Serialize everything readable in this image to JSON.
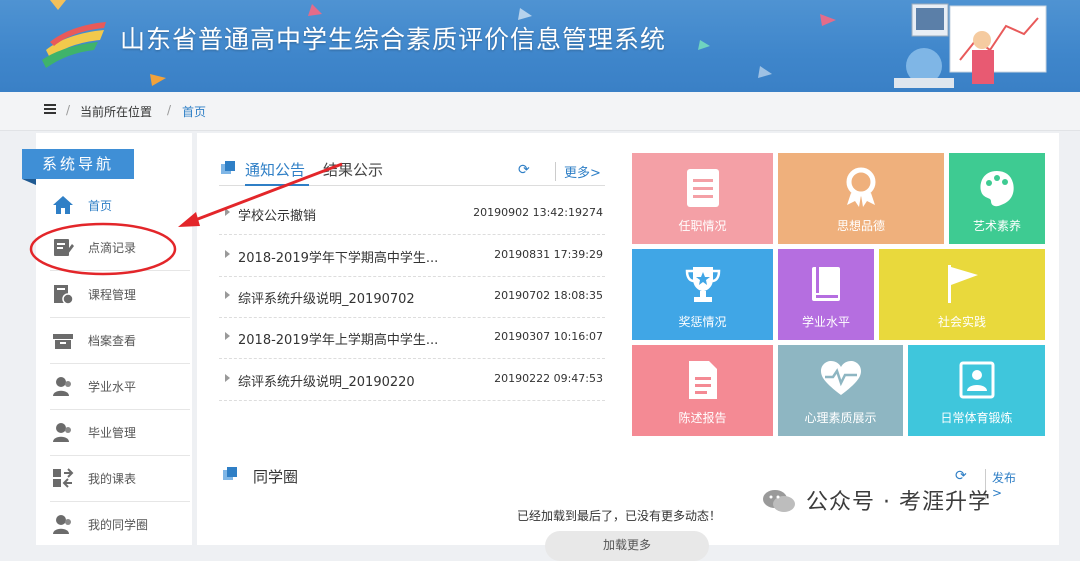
{
  "header": {
    "title": "山东省普通高中学生综合素质评价信息管理系统"
  },
  "breadcrumb": {
    "location_label": "当前所在位置",
    "separator": "/",
    "current": "首页"
  },
  "sidebar": {
    "heading": "系统导航",
    "items": [
      {
        "label": "首页",
        "icon": "home-icon"
      },
      {
        "label": "点滴记录",
        "icon": "edit-record-icon"
      },
      {
        "label": "课程管理",
        "icon": "course-icon"
      },
      {
        "label": "档案查看",
        "icon": "archive-icon"
      },
      {
        "label": "学业水平",
        "icon": "user-icon"
      },
      {
        "label": "毕业管理",
        "icon": "user-icon"
      },
      {
        "label": "我的课表",
        "icon": "schedule-icon"
      },
      {
        "label": "我的同学圈",
        "icon": "user-icon"
      }
    ]
  },
  "notices": {
    "tab_active": "通知公告",
    "tab_other": "结果公示",
    "refresh_icon": "refresh-icon",
    "more_label": "更多>",
    "items": [
      {
        "title": "学校公示撤销",
        "date": "20190902 13:42:19274"
      },
      {
        "title": "2018-2019学年下学期高中学生...",
        "date": "20190831 17:39:29"
      },
      {
        "title": "综评系统升级说明_20190702",
        "date": "20190702 18:08:35"
      },
      {
        "title": "2018-2019学年上学期高中学生...",
        "date": "20190307 10:16:07"
      },
      {
        "title": "综评系统升级说明_20190220",
        "date": "20190222 09:47:53"
      }
    ]
  },
  "tiles": [
    {
      "label": "任职情况",
      "color": "#f4a0a6"
    },
    {
      "label": "思想品德",
      "color": "#efb07c"
    },
    {
      "label": "艺术素养",
      "color": "#3ecb92"
    },
    {
      "label": "奖惩情况",
      "color": "#40a6e6"
    },
    {
      "label": "学业水平",
      "color": "#b56ee0"
    },
    {
      "label": "社会实践",
      "color": "#e9d93c"
    },
    {
      "label": "陈述报告",
      "color": "#f48a94"
    },
    {
      "label": "心理素质展示",
      "color": "#8eb6c2"
    },
    {
      "label": "日常体育锻炼",
      "color": "#3fc6dc"
    }
  ],
  "classmates": {
    "title": "同学圈",
    "post_label": "发布>",
    "end_message": "已经加载到最后了，已没有更多动态！",
    "load_more": "加载更多"
  },
  "watermark": {
    "text": "公众号 · 考涯升学"
  }
}
